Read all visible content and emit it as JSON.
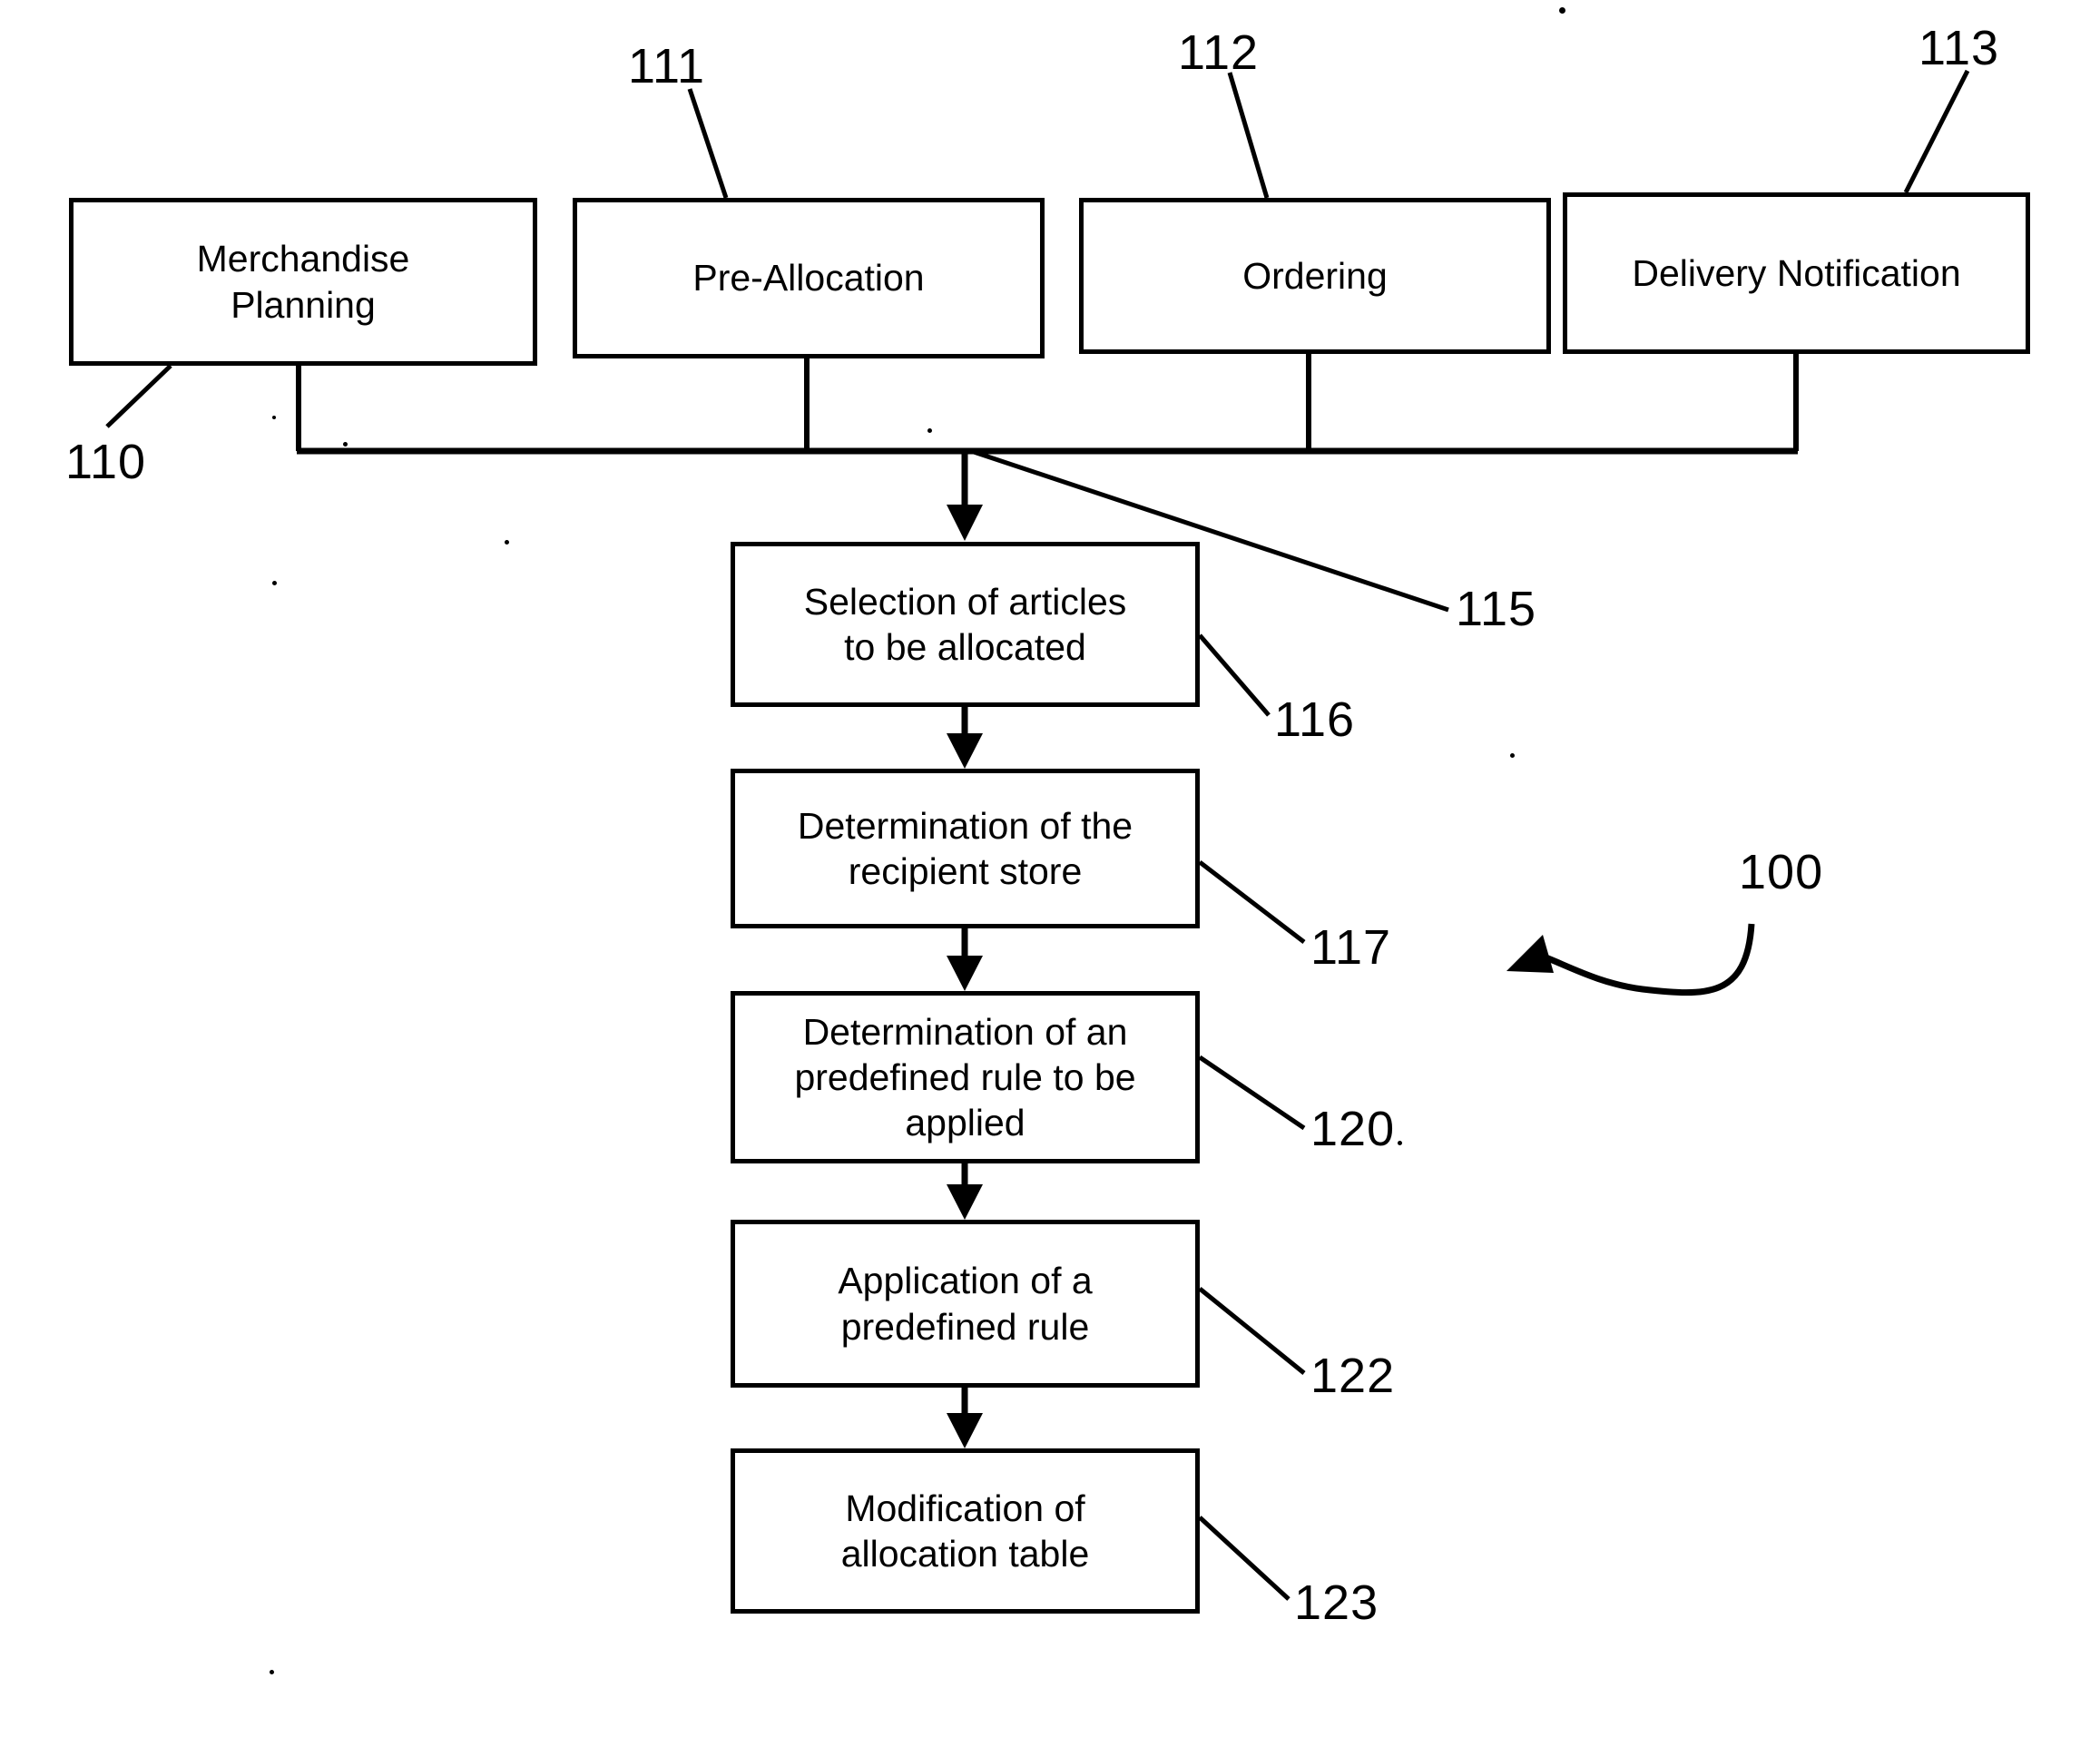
{
  "figure": {
    "type": "patent-flowchart",
    "reference_numeral": "100",
    "background_color": "#ffffff",
    "line_color": "#000000"
  },
  "top_row": {
    "boxes": [
      {
        "label": "Merchandise\nPlanning",
        "ref": "110"
      },
      {
        "label": "Pre-Allocation",
        "ref": "111"
      },
      {
        "label": "Ordering",
        "ref": "112"
      },
      {
        "label": "Delivery Notification",
        "ref": "113"
      }
    ]
  },
  "bus": {
    "ref": "115"
  },
  "process_steps": [
    {
      "label": "Selection of articles\nto be allocated",
      "ref": "116"
    },
    {
      "label": "Determination of the\nrecipient store",
      "ref": "117"
    },
    {
      "label": "Determination of an\npredefined rule to be\napplied",
      "ref": "120"
    },
    {
      "label": "Application of a\npredefined rule",
      "ref": "122"
    },
    {
      "label": "Modification of\nallocation table",
      "ref": "123"
    }
  ],
  "callout": {
    "label": "100"
  },
  "chart_data": {
    "type": "table",
    "title": "",
    "categories": [
      "Merchandise Planning",
      "Pre-Allocation",
      "Ordering",
      "Delivery Notification",
      "Selection of articles to be allocated",
      "Determination of the recipient store",
      "Determination of an predefined rule to be applied",
      "Application of a predefined rule",
      "Modification of allocation table"
    ],
    "values": [
      110,
      111,
      112,
      113,
      116,
      117,
      120,
      122,
      123
    ]
  }
}
